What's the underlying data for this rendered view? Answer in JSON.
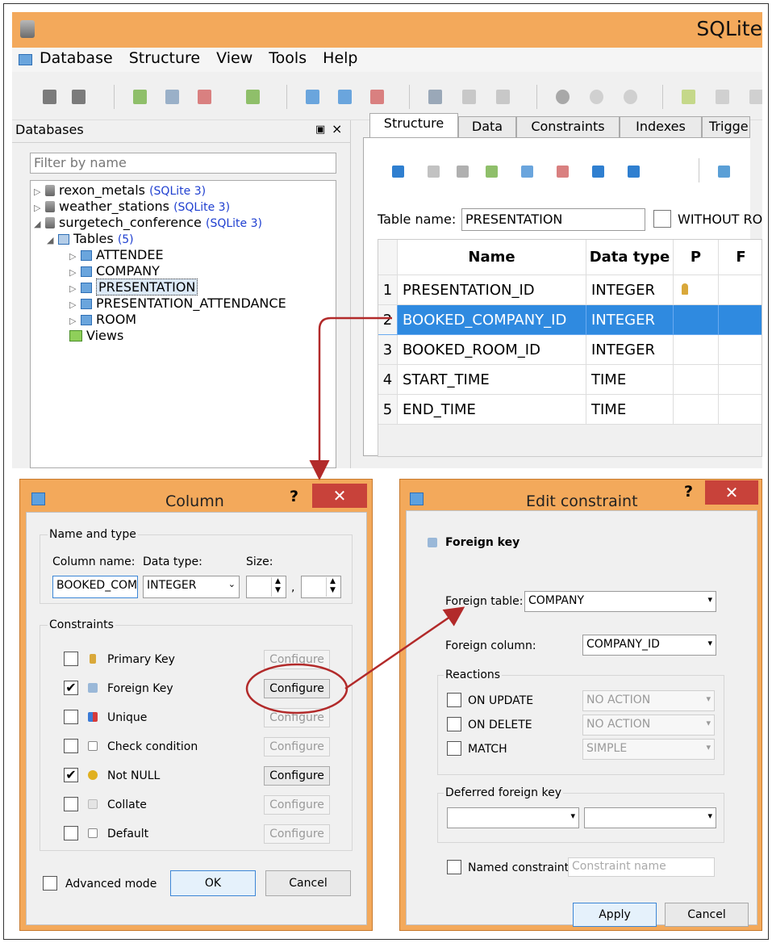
{
  "app": {
    "title": "SQLite"
  },
  "menu": [
    "Database",
    "Structure",
    "View",
    "Tools",
    "Help"
  ],
  "db_panel": {
    "title": "Databases",
    "float_icon": "float-icon",
    "close": "×",
    "filter_placeholder": "Filter by name",
    "databases": [
      {
        "name": "rexon_metals",
        "type": "(SQLite 3)"
      },
      {
        "name": "weather_stations",
        "type": "(SQLite 3)"
      },
      {
        "name": "surgetech_conference",
        "type": "(SQLite 3)"
      }
    ],
    "tables_label": "Tables",
    "tables_count": "(5)",
    "tables": [
      "ATTENDEE",
      "COMPANY",
      "PRESENTATION",
      "PRESENTATION_ATTENDANCE",
      "ROOM"
    ],
    "views_label": "Views"
  },
  "tabs": [
    "Structure",
    "Data",
    "Constraints",
    "Indexes",
    "Trigger"
  ],
  "table_editor": {
    "table_name_label": "Table name:",
    "table_name": "PRESENTATION",
    "without_rowid_label": "WITHOUT RO",
    "columns": [
      "Name",
      "Data type",
      "P",
      "F"
    ],
    "rows": [
      {
        "num": "1",
        "name": "PRESENTATION_ID",
        "type": "INTEGER",
        "pk": true
      },
      {
        "num": "2",
        "name": "BOOKED_COMPANY_ID",
        "type": "INTEGER",
        "pk": false
      },
      {
        "num": "3",
        "name": "BOOKED_ROOM_ID",
        "type": "INTEGER",
        "pk": false
      },
      {
        "num": "4",
        "name": "START_TIME",
        "type": "TIME",
        "pk": false
      },
      {
        "num": "5",
        "name": "END_TIME",
        "type": "TIME",
        "pk": false
      }
    ],
    "selected_row": 2
  },
  "column_dialog": {
    "title": "Column",
    "help": "?",
    "close": "✕",
    "name_type_group": "Name and type",
    "column_name_label": "Column name:",
    "data_type_label": "Data type:",
    "size_label": "Size:",
    "column_name": "BOOKED_COM",
    "data_type": "INTEGER",
    "size_sep": ",",
    "constraints_group": "Constraints",
    "constraints": [
      {
        "label": "Primary Key",
        "checked": false,
        "configure": "Configure",
        "enabled": false,
        "icon": "key-icon"
      },
      {
        "label": "Foreign Key",
        "checked": true,
        "configure": "Configure",
        "enabled": true,
        "icon": "foreign-key-icon"
      },
      {
        "label": "Unique",
        "checked": false,
        "configure": "Configure",
        "enabled": false,
        "icon": "unique-icon"
      },
      {
        "label": "Check condition",
        "checked": false,
        "configure": "Configure",
        "enabled": false,
        "icon": "check-condition-icon"
      },
      {
        "label": "Not NULL",
        "checked": true,
        "configure": "Configure",
        "enabled": true,
        "icon": "not-null-icon"
      },
      {
        "label": "Collate",
        "checked": false,
        "configure": "Configure",
        "enabled": false,
        "icon": "collate-icon"
      },
      {
        "label": "Default",
        "checked": false,
        "configure": "Configure",
        "enabled": false,
        "icon": "default-icon"
      }
    ],
    "advanced_mode": "Advanced mode",
    "ok": "OK",
    "cancel": "Cancel",
    "check_mark": "✔"
  },
  "constraint_dialog": {
    "title": "Edit constraint",
    "help": "?",
    "close": "✕",
    "heading": "Foreign key",
    "foreign_table_label": "Foreign table:",
    "foreign_table": "COMPANY",
    "foreign_column_label": "Foreign column:",
    "foreign_column": "COMPANY_ID",
    "reactions_group": "Reactions",
    "reactions": [
      {
        "label": "ON UPDATE",
        "value": "NO ACTION"
      },
      {
        "label": "ON DELETE",
        "value": "NO ACTION"
      },
      {
        "label": "MATCH",
        "value": "SIMPLE"
      }
    ],
    "deferred_group": "Deferred foreign key",
    "named_constraint_label": "Named constraint",
    "constraint_name_placeholder": "Constraint name",
    "apply": "Apply",
    "cancel": "Cancel",
    "dropdown_arrow": "▾"
  },
  "colors": {
    "title_bar": "#f3a95b",
    "selection": "#2f8ae0",
    "annotation": "#b22a2a"
  }
}
